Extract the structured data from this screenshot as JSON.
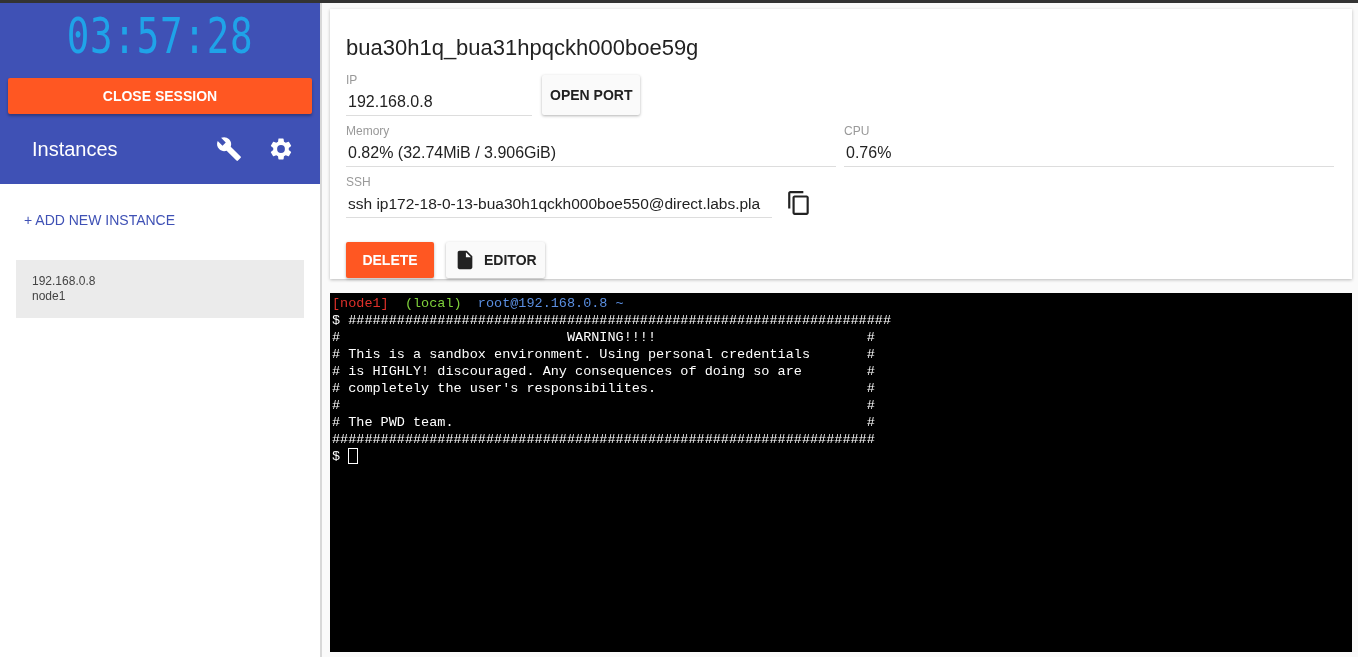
{
  "sidebar": {
    "timer": "03:57:28",
    "close_button": "CLOSE SESSION",
    "title": "Instances",
    "add_button": "+ ADD NEW INSTANCE",
    "instances": [
      {
        "ip": "192.168.0.8",
        "name": "node1",
        "selected": true
      }
    ]
  },
  "instance": {
    "title": "bua30h1q_bua31hpqckh000boe59g",
    "ip": {
      "label": "IP",
      "value": "192.168.0.8"
    },
    "open_port_button": "OPEN PORT",
    "memory": {
      "label": "Memory",
      "value": "0.82% (32.74MiB / 3.906GiB)"
    },
    "cpu": {
      "label": "CPU",
      "value": "0.76%"
    },
    "ssh": {
      "label": "SSH",
      "value": "ssh ip172-18-0-13-bua30h1qckh000boe550@direct.labs.pla"
    },
    "delete_button": "DELETE",
    "editor_button": "EDITOR"
  },
  "terminal": {
    "prompt": [
      {
        "text": "[node1]",
        "color": "#e0302a"
      },
      {
        "text": "(local)",
        "color": "#7fd13b"
      },
      {
        "text": "root@192.168.0.8 ~",
        "color": "#5a8ee0"
      }
    ],
    "lines": [
      "$ ###################################################################",
      "#                            WARNING!!!!                          #",
      "# This is a sandbox environment. Using personal credentials       #",
      "# is HIGHLY! discouraged. Any consequences of doing so are        #",
      "# completely the user's responsibilites.                          #",
      "#                                                                 #",
      "# The PWD team.                                                   #",
      "###################################################################"
    ],
    "input_prompt": "$"
  }
}
